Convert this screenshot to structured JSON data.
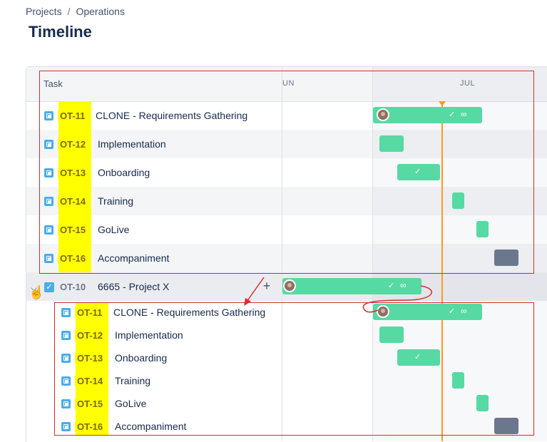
{
  "breadcrumb": {
    "project": "Projects",
    "separator": "/",
    "section": "Operations"
  },
  "page": {
    "title": "Timeline"
  },
  "header": {
    "task_label": "Task",
    "month_jun": "UN",
    "month_jul": "JUL"
  },
  "parent": {
    "key": "OT-10",
    "summary": "6665 - Project X",
    "add_label": "+",
    "collapse_icon": "chevron-down-icon"
  },
  "top_rows": [
    {
      "key": "OT-11",
      "summary": "CLONE - Requirements Gathering"
    },
    {
      "key": "OT-12",
      "summary": "Implementation"
    },
    {
      "key": "OT-13",
      "summary": "Onboarding"
    },
    {
      "key": "OT-14",
      "summary": "Training"
    },
    {
      "key": "OT-15",
      "summary": "GoLive"
    },
    {
      "key": "OT-16",
      "summary": "Accompaniment"
    }
  ],
  "child_rows": [
    {
      "key": "OT-11",
      "summary": "CLONE - Requirements Gathering"
    },
    {
      "key": "OT-12",
      "summary": "Implementation"
    },
    {
      "key": "OT-13",
      "summary": "Onboarding"
    },
    {
      "key": "OT-14",
      "summary": "Training"
    },
    {
      "key": "OT-15",
      "summary": "GoLive"
    },
    {
      "key": "OT-16",
      "summary": "Accompaniment"
    }
  ],
  "icons": {
    "done": "✓",
    "link": "🔗",
    "issue_type": "subtask-icon",
    "parent_type": "task-icon"
  },
  "colors": {
    "bar_done": "#57d9a3",
    "bar_todo": "#6b778c",
    "today": "#ff991f",
    "highlight": "#ffff00",
    "annotation": "#d32f2f"
  }
}
